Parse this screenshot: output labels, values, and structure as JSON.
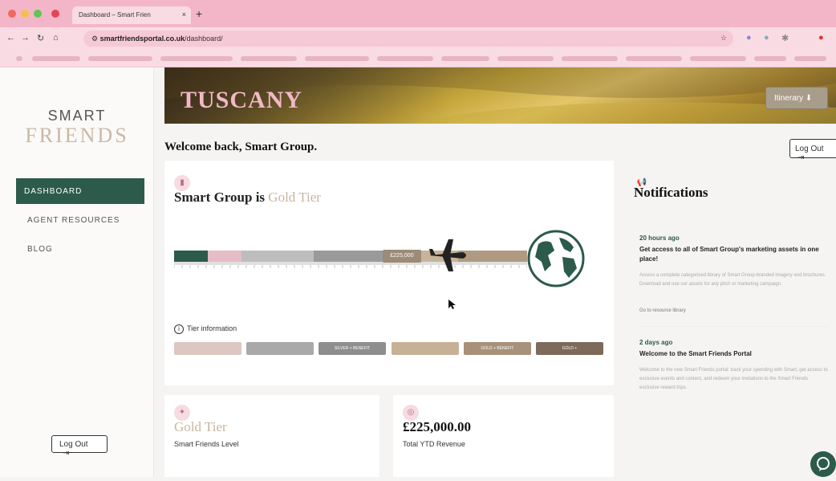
{
  "browser": {
    "tab_title": "Dashboard – Smart Frien",
    "url_host": "smartfriendsportal.co.uk",
    "url_path": "/dashboard/"
  },
  "sidebar": {
    "logo_line1": "SMART",
    "logo_line2": "FRIENDS",
    "items": [
      {
        "label": "DASHBOARD",
        "active": true
      },
      {
        "label": "AGENT RESOURCES",
        "active": false
      },
      {
        "label": "BLOG",
        "active": false
      }
    ],
    "logout_label": "Log Out"
  },
  "hero": {
    "title": "TUSCANY",
    "itinerary_label": "Itinerary ⬇"
  },
  "header": {
    "welcome": "Welcome back, Smart Group.",
    "logout_label": "Log Out"
  },
  "tier_card": {
    "title_prefix": "Smart Group is ",
    "title_tier": "Gold Tier",
    "current_value": "£225,000",
    "tier_info_label": "Tier information",
    "tier_buttons": [
      {
        "label": "",
        "color": "#dcc7c2"
      },
      {
        "label": "",
        "color": "#a9a9a9"
      },
      {
        "label": "SILVER + BENEFIT",
        "color": "#8e8e8e"
      },
      {
        "label": "",
        "color": "#c7b196"
      },
      {
        "label": "GOLD + BENEFIT",
        "color": "#a8917a"
      },
      {
        "label": "GOLD +",
        "color": "#7d6a5a"
      }
    ]
  },
  "notifications": {
    "title": "Notifications",
    "items": [
      {
        "time": "20 hours ago",
        "headline": "Get access to all of Smart Group's marketing assets in one place!",
        "body": "Access a complete categorised library of Smart Group-branded imagery and brochures. Download and use our assets for any pitch or marketing campaign.",
        "link": "Go to resource library"
      },
      {
        "time": "2 days ago",
        "headline": "Welcome to the Smart Friends Portal",
        "body": "Welcome to the new Smart Friends portal: track your spending with Smart, get access to exclusive events and content, and redeem your invitations to the Smart Friends exclusive reward trips."
      }
    ]
  },
  "stats": {
    "level_value": "Gold Tier",
    "level_label": "Smart Friends Level",
    "revenue_value": "£225,000.00",
    "revenue_label": "Total YTD Revenue"
  },
  "colors": {
    "brand_green": "#2c5a4b",
    "brand_pink": "#f2b8c7",
    "gold": "#c8b6a0"
  },
  "progress": {
    "segments": [
      "#2c5a4b",
      "#e6bcc5",
      "#bdbdbd",
      "#9a9a9a",
      "#c8b49a",
      "#b09b82"
    ]
  }
}
